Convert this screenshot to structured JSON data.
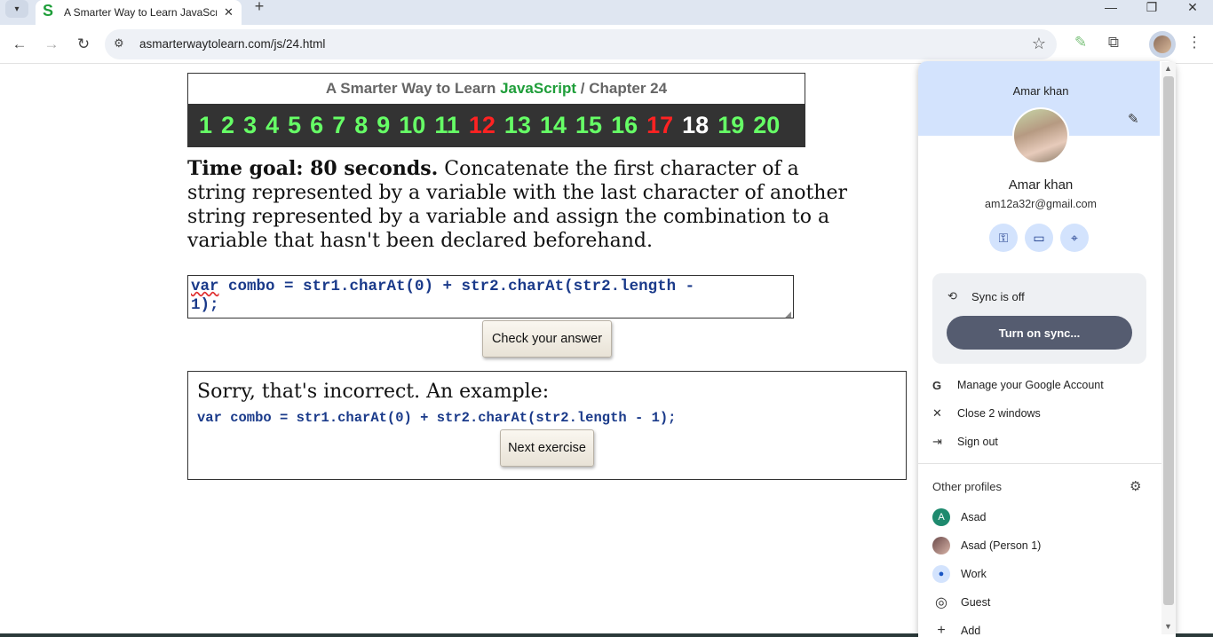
{
  "browser": {
    "tab": {
      "title": "A Smarter Way to Learn JavaScri",
      "favicon": "S",
      "close_icon": "✕"
    },
    "new_tab": "+",
    "window_controls": {
      "minimize": "—",
      "restore": "❐",
      "close": "✕"
    },
    "nav": {
      "back": "←",
      "forward": "→",
      "reload": "↻"
    },
    "url": "asmarterwaytolearn.com/js/24.html",
    "bookmark_icon": "☆",
    "extensions_icon": "⧉",
    "menu_icon": "⋮"
  },
  "header": {
    "title_prefix": "A Smarter Way to Learn ",
    "title_highlight": "JavaScript",
    "title_suffix": " / Chapter 24",
    "chapters": [
      "1",
      "2",
      "3",
      "4",
      "5",
      "6",
      "7",
      "8",
      "9",
      "10",
      "11",
      "12",
      "13",
      "14",
      "15",
      "16",
      "17",
      "18",
      "19",
      "20"
    ],
    "chapter_colors": {
      "default": "#66ff66",
      "red": "#ff2222",
      "current": "#ffffff"
    },
    "red_chapters": [
      "12",
      "17"
    ],
    "current_chapter": "18"
  },
  "exercise": {
    "goal_bold": "Time goal: 80 seconds.",
    "goal_text": " Concatenate the first character of a string represented by a variable with the last character of another string represented by a variable and assign the combination to a variable that hasn't been declared beforehand.",
    "answer_keyword": "var",
    "answer_rest_line1": " combo = str1.charAt(0) + str2.charAt(str2.length -",
    "answer_line2": "1);",
    "check_button": "Check your answer"
  },
  "result": {
    "message": "Sorry, that's incorrect. An example:",
    "example_code": "var combo = str1.charAt(0) + str2.charAt(str2.length - 1);",
    "next_button": "Next exercise"
  },
  "profile_panel": {
    "header_name": "Amar khan",
    "name": "Amar khan",
    "email": "am12a32r@gmail.com",
    "quick_icons": [
      "key-icon",
      "card-icon",
      "location-icon"
    ],
    "sync_status": "Sync is off",
    "sync_button": "Turn on sync...",
    "menu": [
      {
        "icon": "G",
        "label": "Manage your Google Account"
      },
      {
        "icon": "✕",
        "label": "Close 2 windows"
      },
      {
        "icon": "⇥",
        "label": "Sign out"
      }
    ],
    "other_profiles_title": "Other profiles",
    "profiles": [
      {
        "initial": "A",
        "label": "Asad"
      },
      {
        "initial": "",
        "label": "Asad (Person 1)"
      },
      {
        "initial": "●",
        "label": "Work"
      },
      {
        "initial": "◎",
        "label": "Guest"
      },
      {
        "initial": "+",
        "label": "Add"
      }
    ]
  }
}
